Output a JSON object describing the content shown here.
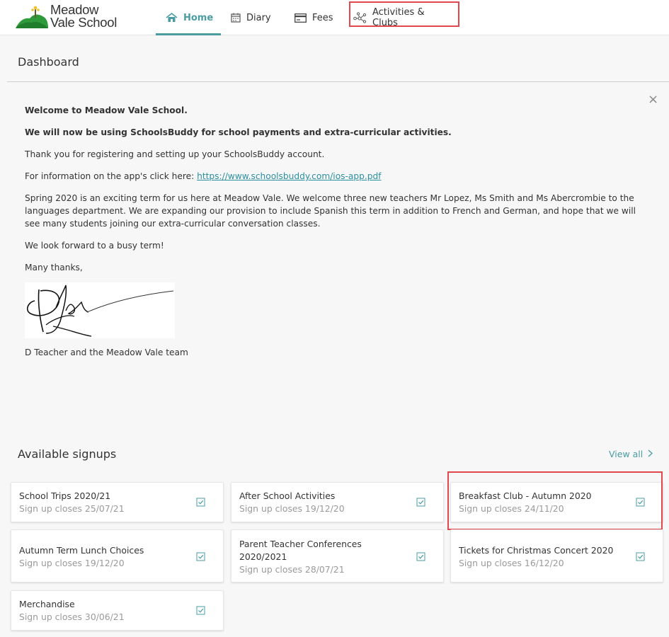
{
  "header": {
    "logo_line1": "Meadow",
    "logo_line2": "Vale School",
    "nav": [
      {
        "label": "Home",
        "icon": "home-icon",
        "active": true
      },
      {
        "label": "Diary",
        "icon": "calendar-icon"
      },
      {
        "label": "Fees",
        "icon": "credit-card-icon"
      },
      {
        "label": "Activities & Clubs",
        "icon": "network-icon"
      }
    ]
  },
  "dashboard": {
    "title": "Dashboard",
    "close": "×",
    "message": {
      "welcome": "Welcome to Meadow Vale School.",
      "announcement": "We will now be using SchoolsBuddy for school payments and extra-curricular activities.",
      "thanks": "Thank you for registering and setting up your SchoolsBuddy account.",
      "app_info_prefix": "For information on the app's click here: ",
      "app_link": "https://www.schoolsbuddy.com/ios-app.pdf",
      "spring": "Spring 2020 is an exciting term for us here at Meadow Vale.  We welcome three new teachers Mr Lopez, Ms Smith and Ms Abercrombie to the languages department.  We are expanding our provision to include Spanish this term in addition to French and German, and hope that we will see many students joining our extra-curricular conversation classes.",
      "look_forward": "We look forward to a busy term!",
      "closing": "Many thanks,",
      "signoff": "D Teacher and the Meadow Vale team"
    }
  },
  "signups": {
    "title": "Available signups",
    "view_all": "View all",
    "cards": [
      {
        "title": "School Trips 2020/21",
        "closes": "Sign up closes 25/07/21"
      },
      {
        "title": "After School Activities",
        "closes": "Sign up closes 19/12/20"
      },
      {
        "title": "Breakfast Club - Autumn 2020",
        "closes": "Sign up closes 24/11/20"
      },
      {
        "title": "Autumn Term Lunch Choices",
        "closes": "Sign up closes 19/12/20"
      },
      {
        "title": "Parent Teacher Conferences 2020/2021",
        "closes": "Sign up closes 28/07/21"
      },
      {
        "title": "Tickets for Christmas Concert 2020",
        "closes": "Sign up closes 16/12/20"
      },
      {
        "title": "Merchandise",
        "closes": "Sign up closes 30/06/21"
      }
    ]
  },
  "colors": {
    "accent": "#4a9ca3",
    "highlight": "#e0484d",
    "logo_green": "#2e9a3a"
  }
}
